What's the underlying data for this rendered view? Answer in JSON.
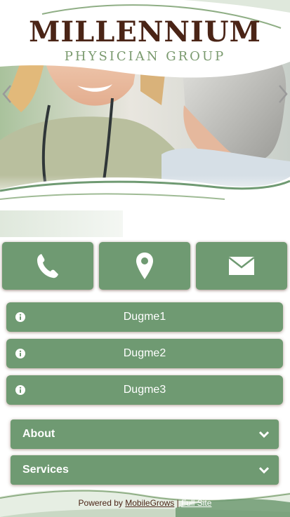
{
  "header": {
    "logo_title": "MILLENNIUM",
    "logo_subtitle": "PHYSICIAN GROUP"
  },
  "slider": {
    "prev_icon": "chevron-left-icon",
    "next_icon": "chevron-right-icon"
  },
  "actions": [
    {
      "icon": "phone-icon"
    },
    {
      "icon": "map-pin-icon"
    },
    {
      "icon": "envelope-icon"
    }
  ],
  "info_buttons": [
    {
      "label": "Dugme1",
      "icon": "info-icon"
    },
    {
      "label": "Dugme2",
      "icon": "info-icon"
    },
    {
      "label": "Dugme3",
      "icon": "info-icon"
    }
  ],
  "accordions": [
    {
      "label": "About",
      "icon": "chevron-down-icon"
    },
    {
      "label": "Services",
      "icon": "chevron-down-icon"
    }
  ],
  "footer": {
    "powered_by": "Powered by",
    "brand_link": "MobileGrows",
    "separator": "|",
    "full_site_link": "Full Site"
  },
  "colors": {
    "button_green": "#6f9a72",
    "logo_brown": "#4a2416",
    "logo_green": "#7a9a6e",
    "background": "#ffffff"
  }
}
